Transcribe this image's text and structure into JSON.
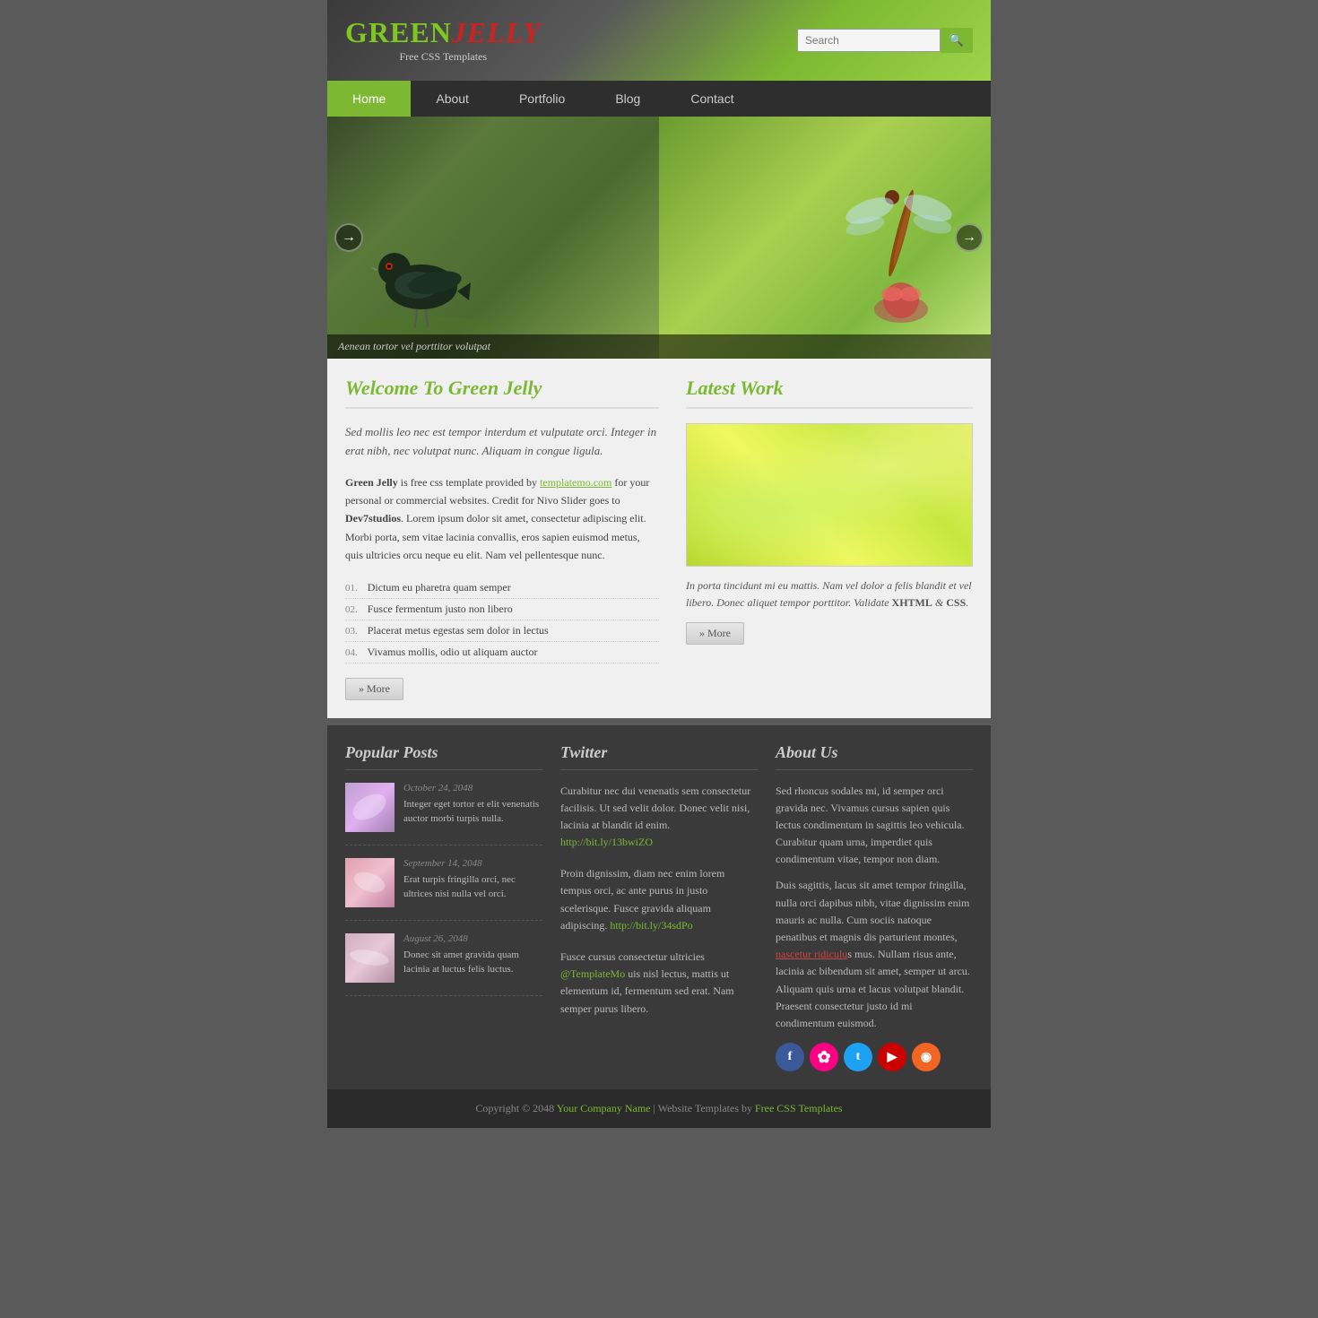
{
  "header": {
    "logo_green": "GREEN",
    "logo_red": "JELLY",
    "logo_subtitle": "Free CSS Templates",
    "search_placeholder": "Search",
    "search_button": "🔍"
  },
  "nav": {
    "items": [
      {
        "label": "Home",
        "active": true
      },
      {
        "label": "About",
        "active": false
      },
      {
        "label": "Portfolio",
        "active": false
      },
      {
        "label": "Blog",
        "active": false
      },
      {
        "label": "Contact",
        "active": false
      }
    ]
  },
  "slider": {
    "caption": "Aenean tortor vel porttitor volutpat"
  },
  "welcome": {
    "title": "Welcome To Green Jelly",
    "intro": "Sed mollis leo nec est tempor interdum et vulputate orci. Integer in erat nibh, nec volutpat nunc. Aliquam in congue ligula.",
    "body1": "Green Jelly is free css template provided by templatemo.com for your personal or commercial websites. Credit for Nivo Slider goes to Dev7studios. Lorem ipsum dolor sit amet, consectetur adipiscing elit. Morbi porta, sem vitae lacinia convallis, eros sapien euismod metus, quis ultricies orcu neque eu elit. Nam vel pellentesque nunc.",
    "list": [
      {
        "num": "01.",
        "text": "Dictum eu pharetra quam semper"
      },
      {
        "num": "02.",
        "text": "Fusce fermentum justo non libero"
      },
      {
        "num": "03.",
        "text": "Placerat metus egestas sem dolor in lectus"
      },
      {
        "num": "04.",
        "text": "Vivamus mollis, odio ut aliquam auctor"
      }
    ],
    "more_label": "» More"
  },
  "latest_work": {
    "title": "Latest Work",
    "caption": "In porta tincidunt mi eu mattis. Nam vel dolor a felis blandit et vel libero. Donec aliquet tempor porttitor. Validate XHTML & CSS.",
    "more_label": "» More"
  },
  "footer": {
    "popular_posts": {
      "title": "Popular Posts",
      "posts": [
        {
          "date": "October 24, 2048",
          "text": "Integer eget tortor et elit venenatis auctor morbi turpis nulla."
        },
        {
          "date": "September 14, 2048",
          "text": "Erat turpis fringilla orci, nec ultrices nisi nulla vel orci."
        },
        {
          "date": "August 26, 2048",
          "text": "Donec sit amet gravida quam lacinia at luctus felis luctus."
        }
      ]
    },
    "twitter": {
      "title": "Twitter",
      "tweets": [
        {
          "text": "Curabitur nec dui venenatis sem consectetur facilisis. Ut sed velit dolor. Donec velit nisi, lacinia at blandit id enim.",
          "link": "http://bit.ly/13bwiZO"
        },
        {
          "text": "Proin dignissim, diam nec enim lorem tempus orci, ac ante purus in justo scelerisque. Fusce gravida aliquam adipiscing.",
          "link": "http://bit.ly/34sdPo"
        },
        {
          "text": "Fusce cursus consectetur ultricies @TemplateMo uis nisl lectus, mattis ut elementum id, fermentum sed erat. Nam semper purus libero.",
          "link": null
        }
      ]
    },
    "about_us": {
      "title": "About Us",
      "text1": "Sed rhoncus sodales mi, id semper orci gravida nec. Vivamus cursus sapien quis lectus condimentum in sagittis leo vehicula. Curabitur quam urna, imperdiet quis condimentum vitae, tempor non diam.",
      "text2": "Duis sagittis, lacus sit amet tempor fringilla, nulla orci dapibus nibh, vitae dignissim enim mauris ac nulla. Cum sociis natoque penatibus et magnis dis parturient montes, nascetur ridiculus mus. Nullam risus ante, lacinia ac bibendum sit amet, semper ut arcu. Aliquam quis urna et lacus volutpat blandit. Praesent consectetur justo id mi condimentum euismod.",
      "social": [
        {
          "icon": "f",
          "label": "Facebook",
          "class": "si-fb"
        },
        {
          "icon": "✿",
          "label": "Flickr",
          "class": "si-fl"
        },
        {
          "icon": "t",
          "label": "Twitter",
          "class": "si-tw"
        },
        {
          "icon": "▶",
          "label": "YouTube",
          "class": "si-yt"
        },
        {
          "icon": "◉",
          "label": "RSS",
          "class": "si-rss"
        }
      ]
    }
  },
  "footer_bottom": {
    "text": "Copyright © 2048 ",
    "company": "Your Company Name",
    "mid": " | Website Templates by ",
    "templates": "Free CSS Templates"
  }
}
